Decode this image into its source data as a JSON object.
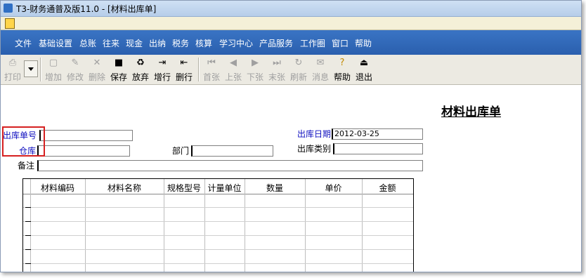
{
  "window": {
    "title": "T3-财务通普及版11.0 - [材料出库单]"
  },
  "menu": [
    "文件",
    "基础设置",
    "总账",
    "往来",
    "现金",
    "出纳",
    "税务",
    "核算",
    "学习中心",
    "产品服务",
    "工作圈",
    "窗口",
    "帮助"
  ],
  "toolbar": {
    "print": "打印",
    "add": "增加",
    "edit": "修改",
    "delete": "删除",
    "save": "保存",
    "discard": "放弃",
    "add_row": "增行",
    "delete_row": "删行",
    "first": "首张",
    "prev": "上张",
    "next": "下张",
    "last": "末张",
    "refresh": "刷新",
    "message": "消息",
    "help": "帮助",
    "exit": "退出"
  },
  "form": {
    "title": "材料出库单",
    "doc_no_label": "出库单号",
    "doc_no_value": "",
    "date_label": "出库日期",
    "date_value": "2012-03-25",
    "warehouse_label": "仓库",
    "warehouse_value": "",
    "dept_label": "部门",
    "dept_value": "",
    "type_label": "出库类别",
    "type_value": "",
    "remark_label": "备注",
    "remark_value": ""
  },
  "grid": {
    "columns": [
      "材料编码",
      "材料名称",
      "规格型号",
      "计量单位",
      "数量",
      "单价",
      "金额"
    ]
  }
}
